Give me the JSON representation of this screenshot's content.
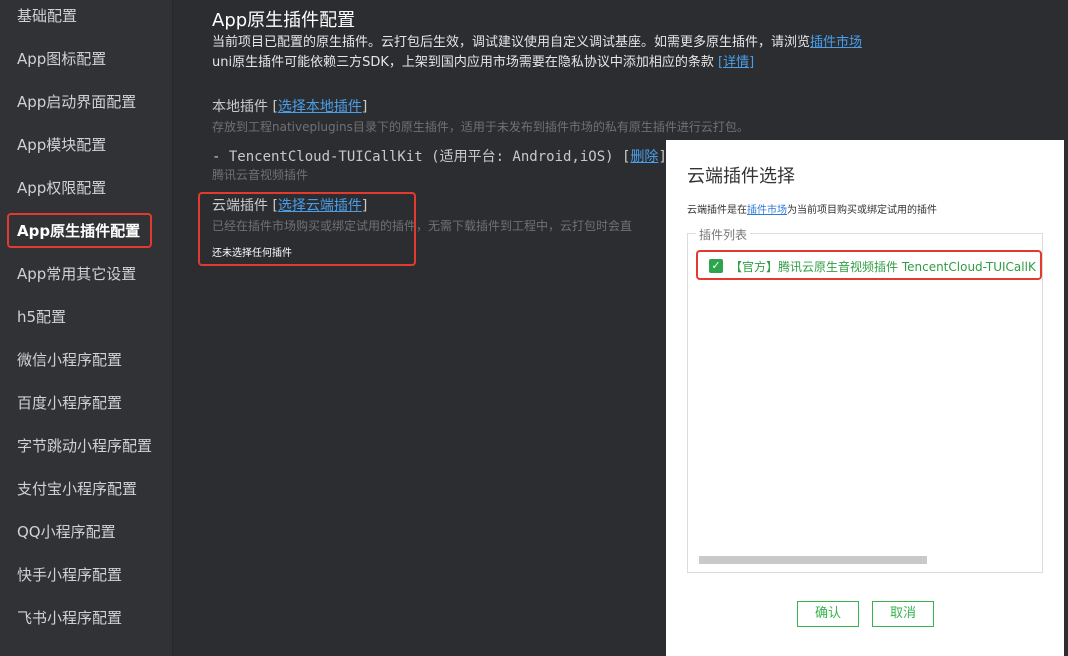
{
  "sidebar": {
    "items": [
      "基础配置",
      "App图标配置",
      "App启动界面配置",
      "App模块配置",
      "App权限配置",
      "App原生插件配置",
      "App常用其它设置",
      "h5配置",
      "微信小程序配置",
      "百度小程序配置",
      "字节跳动小程序配置",
      "支付宝小程序配置",
      "QQ小程序配置",
      "快手小程序配置",
      "飞书小程序配置"
    ],
    "active": "App原生插件配置"
  },
  "main": {
    "title": "App原生插件配置",
    "desc1": "当前项目已配置的原生插件。云打包后生效，调试建议使用自定义调试基座。如需更多原生插件，请浏览",
    "desc1_link": "插件市场",
    "desc2": "uni原生插件可能依赖三方SDK，上架到国内应用市场需要在隐私协议中添加相应的条款",
    "desc2_link": "[详情]",
    "local": {
      "title": "本地插件",
      "link": "选择本地插件",
      "desc": "存放到工程nativeplugins目录下的原生插件，适用于未发布到插件市场的私有原生插件进行云打包。"
    },
    "plugin_item": {
      "text": "- TencentCloud-TUICallKit (适用平台: Android,iOS)",
      "delete_link": "删除",
      "desc": "腾讯云音视频插件"
    },
    "cloud": {
      "title": "云端插件",
      "link": "选择云端插件",
      "desc": "已经在插件市场购买或绑定试用的插件，无需下载插件到工程中，云打包时会直",
      "none": "还未选择任何插件"
    }
  },
  "dialog": {
    "title": "云端插件选择",
    "sub_pre": "云端插件是在",
    "sub_link": "插件市场",
    "sub_post": "为当前项目购买或绑定试用的插件",
    "legend": "插件列表",
    "plugin": "【官方】腾讯云原生音视频插件 TencentCloud-TUICallK",
    "confirm": "确认",
    "cancel": "取消"
  }
}
